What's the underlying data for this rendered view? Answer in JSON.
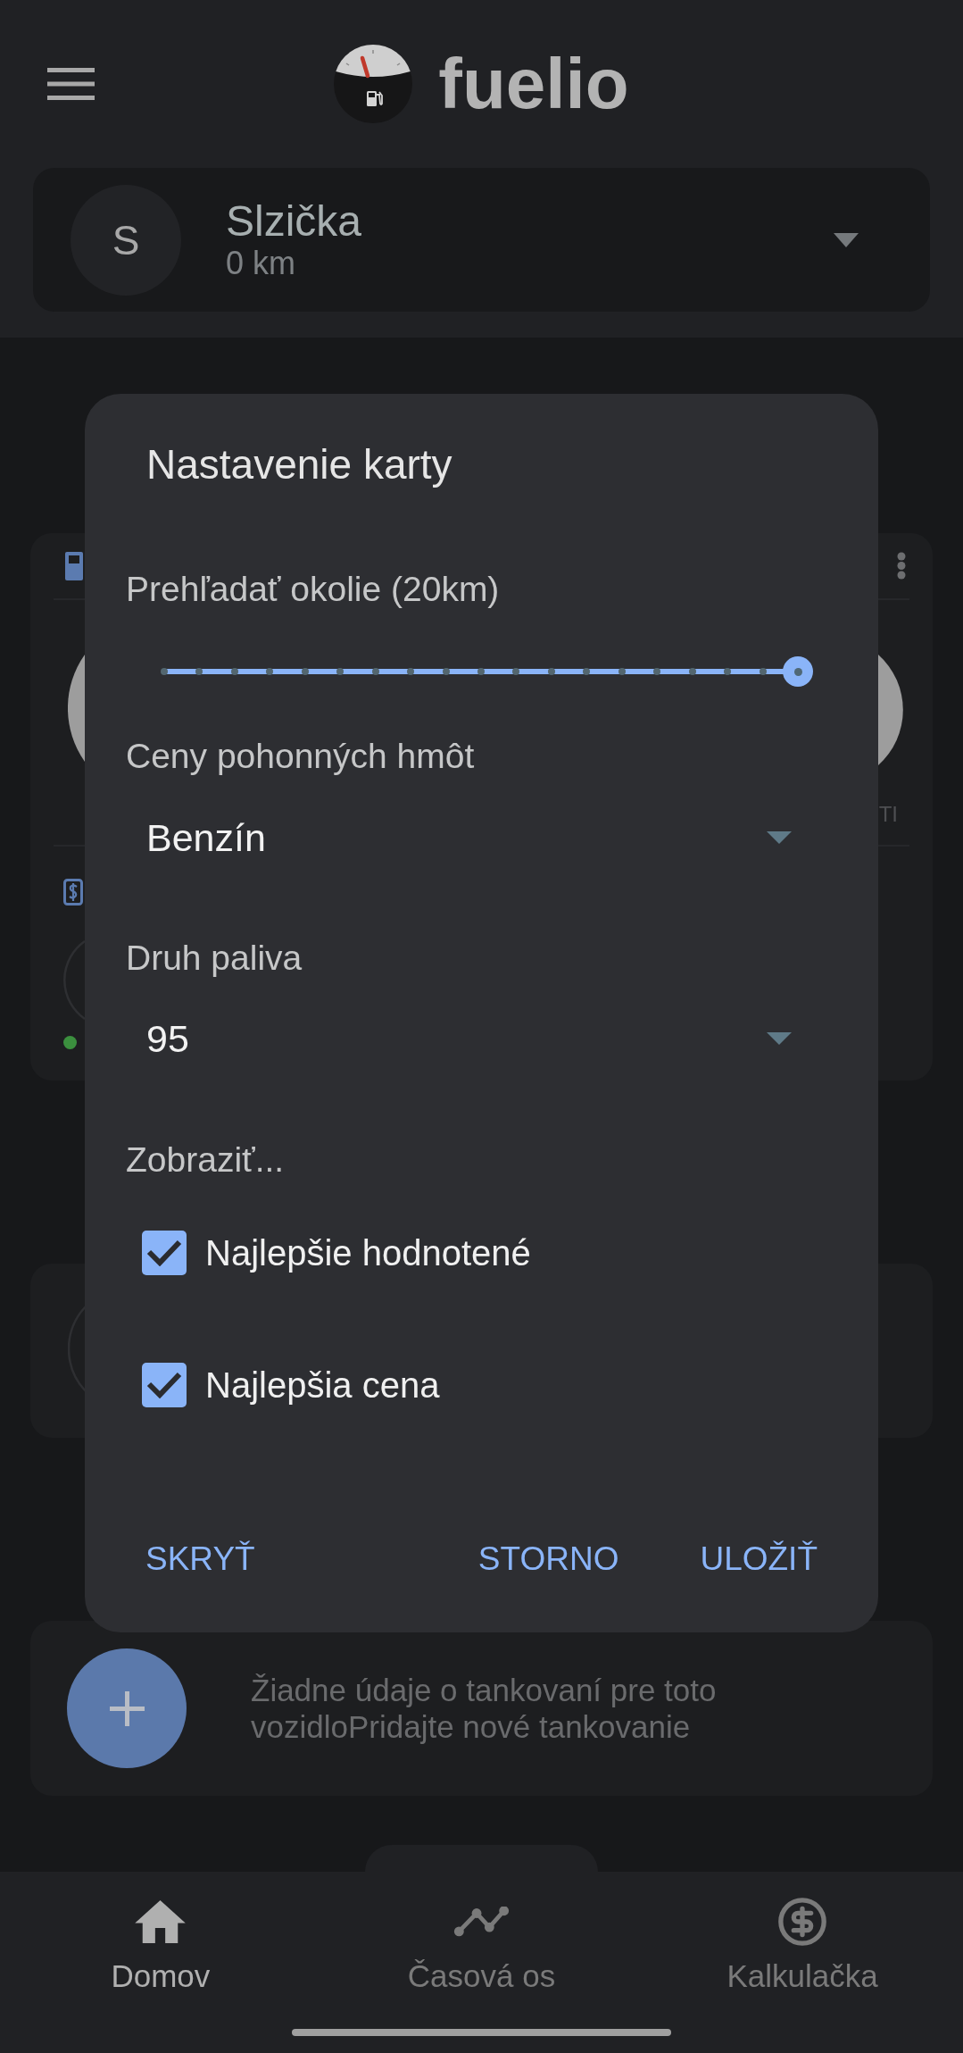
{
  "app_bar": {
    "logo_text": "fuelio"
  },
  "vehicle": {
    "initial": "S",
    "name": "Slzička",
    "odometer": "0 km"
  },
  "stats_card": {
    "label_fragment": "TI"
  },
  "refuel_card": {
    "message": "Žiadne údaje o tankovaní pre toto vozidloPridajte nové tankovanie"
  },
  "dialog": {
    "title": "Nastavenie karty",
    "radius_label": "Prehľadať okolie (20km)",
    "radius_slider": {
      "level": 1
    },
    "dropdowns": [
      {
        "label": "Ceny pohonných hmôt",
        "value": "Benzín"
      },
      {
        "label": "Druh paliva",
        "value": "95"
      }
    ],
    "show_label": "Zobraziť...",
    "options": [
      {
        "label": "Najlepšie hodnotené",
        "checked": true
      },
      {
        "label": "Najlepšia cena",
        "checked": true
      }
    ],
    "neutral_button": "SKRYŤ",
    "buttons": [
      "STORNO",
      "ULOŽIŤ"
    ]
  },
  "bottom_nav": [
    {
      "label": "Domov",
      "selected": true
    },
    {
      "label": "Časová os",
      "selected": false
    },
    {
      "label": "Kalkulačka",
      "selected": false
    }
  ]
}
